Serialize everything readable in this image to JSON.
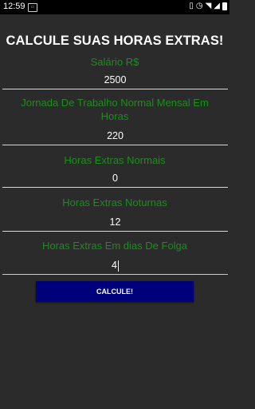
{
  "status_bar": {
    "time": "12:59",
    "notification_icon": "notification-icon",
    "icons": [
      "vibrate-icon",
      "alarm-icon",
      "wifi-icon",
      "signal-icon",
      "battery-icon"
    ]
  },
  "title": "CALCULE SUAS HORAS EXTRAS!",
  "fields": [
    {
      "label": "Salário R$",
      "value": "2500"
    },
    {
      "label": "Jornada De Trabalho Normal Mensal Em Horas",
      "value": "220"
    },
    {
      "label": "Horas Extras Normais",
      "value": "0"
    },
    {
      "label": "Horas Extras Noturnas",
      "value": "12"
    },
    {
      "label": "Horas Extras Em dias De Folga",
      "value": "4"
    }
  ],
  "button_label": "CALCULE!",
  "colors": {
    "background": "#2b2b2b",
    "label": "#1a8f1a",
    "button": "#00007a",
    "active_underline": "#7ff0cf"
  }
}
